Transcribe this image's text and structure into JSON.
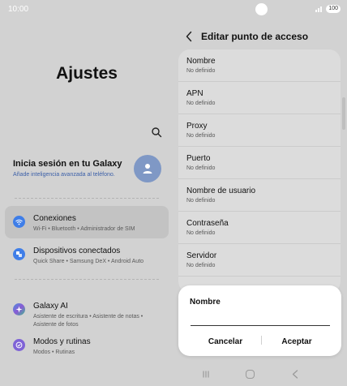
{
  "status_bar": {
    "time": "10:00",
    "battery": "100"
  },
  "left": {
    "title": "Ajustes",
    "account": {
      "title": "Inicia sesión en tu Galaxy",
      "subtitle": "Añade inteligencia avanzada al teléfono."
    },
    "items": [
      {
        "label": "Conexiones",
        "sub": "Wi-Fi  •  Bluetooth  •  Administrador de SIM",
        "icon": "wifi-icon",
        "color": "#3f7ee8",
        "selected": true
      },
      {
        "label": "Dispositivos conectados",
        "sub": "Quick Share  •  Samsung DeX  •  Android Auto",
        "icon": "devices-icon",
        "color": "#3f7ee8",
        "selected": false
      },
      {
        "label": "Galaxy AI",
        "sub": "Asistente de escritura  •  Asistente de notas  •  Asistente de fotos",
        "icon": "sparkle-icon",
        "color": "#4f8fd9",
        "selected": false
      },
      {
        "label": "Modos y rutinas",
        "sub": "Modos  •  Rutinas",
        "icon": "check-circle-icon",
        "color": "#7f63d6",
        "selected": false
      }
    ]
  },
  "right": {
    "title": "Editar punto de acceso",
    "fields": [
      {
        "label": "Nombre",
        "value": "No definido"
      },
      {
        "label": "APN",
        "value": "No definido"
      },
      {
        "label": "Proxy",
        "value": "No definido"
      },
      {
        "label": "Puerto",
        "value": "No definido"
      },
      {
        "label": "Nombre de usuario",
        "value": "No definido"
      },
      {
        "label": "Contraseña",
        "value": "No definido"
      },
      {
        "label": "Servidor",
        "value": "No definido"
      }
    ]
  },
  "dialog": {
    "title": "Nombre",
    "input_value": "",
    "cancel_label": "Cancelar",
    "accept_label": "Aceptar"
  }
}
